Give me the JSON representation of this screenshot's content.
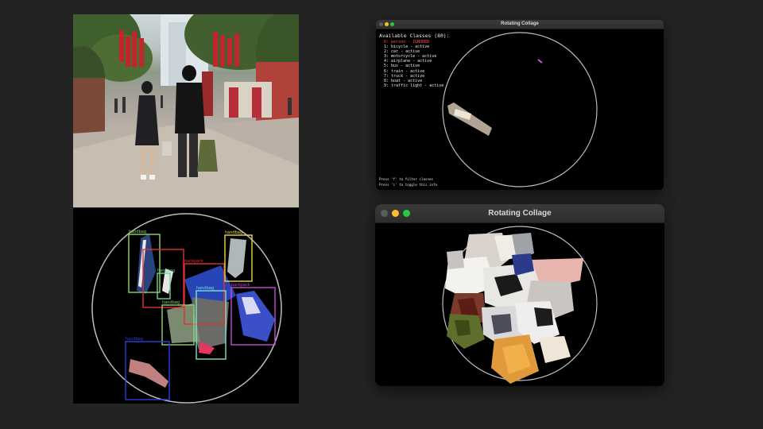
{
  "street_photo": {
    "description_icon": "street-photo"
  },
  "detection_view": {
    "labels": [
      "handbag",
      "handbag",
      "backpack",
      "handbag",
      "handbag",
      "handbag",
      "backpack",
      "handbag",
      "handbag"
    ]
  },
  "top_window": {
    "title": "Rotating Collage",
    "info_title": "Available Classes (80):",
    "classes": [
      {
        "text": "0: person - IGNORED",
        "ignored": true
      },
      {
        "text": "1: bicycle - active",
        "ignored": false
      },
      {
        "text": "2: car - active",
        "ignored": false
      },
      {
        "text": "3: motorcycle - active",
        "ignored": false
      },
      {
        "text": "4: airplane - active",
        "ignored": false
      },
      {
        "text": "5: bus - active",
        "ignored": false
      },
      {
        "text": "6: train - active",
        "ignored": false
      },
      {
        "text": "7: truck - active",
        "ignored": false
      },
      {
        "text": "8: boat - active",
        "ignored": false
      },
      {
        "text": "9: traffic light - active",
        "ignored": false
      }
    ],
    "footer_1": "Press 'f' to filter classes",
    "footer_2": "Press 'i' to toggle this info"
  },
  "bottom_window": {
    "title": "Rotating Collage"
  },
  "colors": {
    "background": "#232323",
    "ignored_red": "#ff4d4d",
    "circle": "#bdbdbd"
  }
}
